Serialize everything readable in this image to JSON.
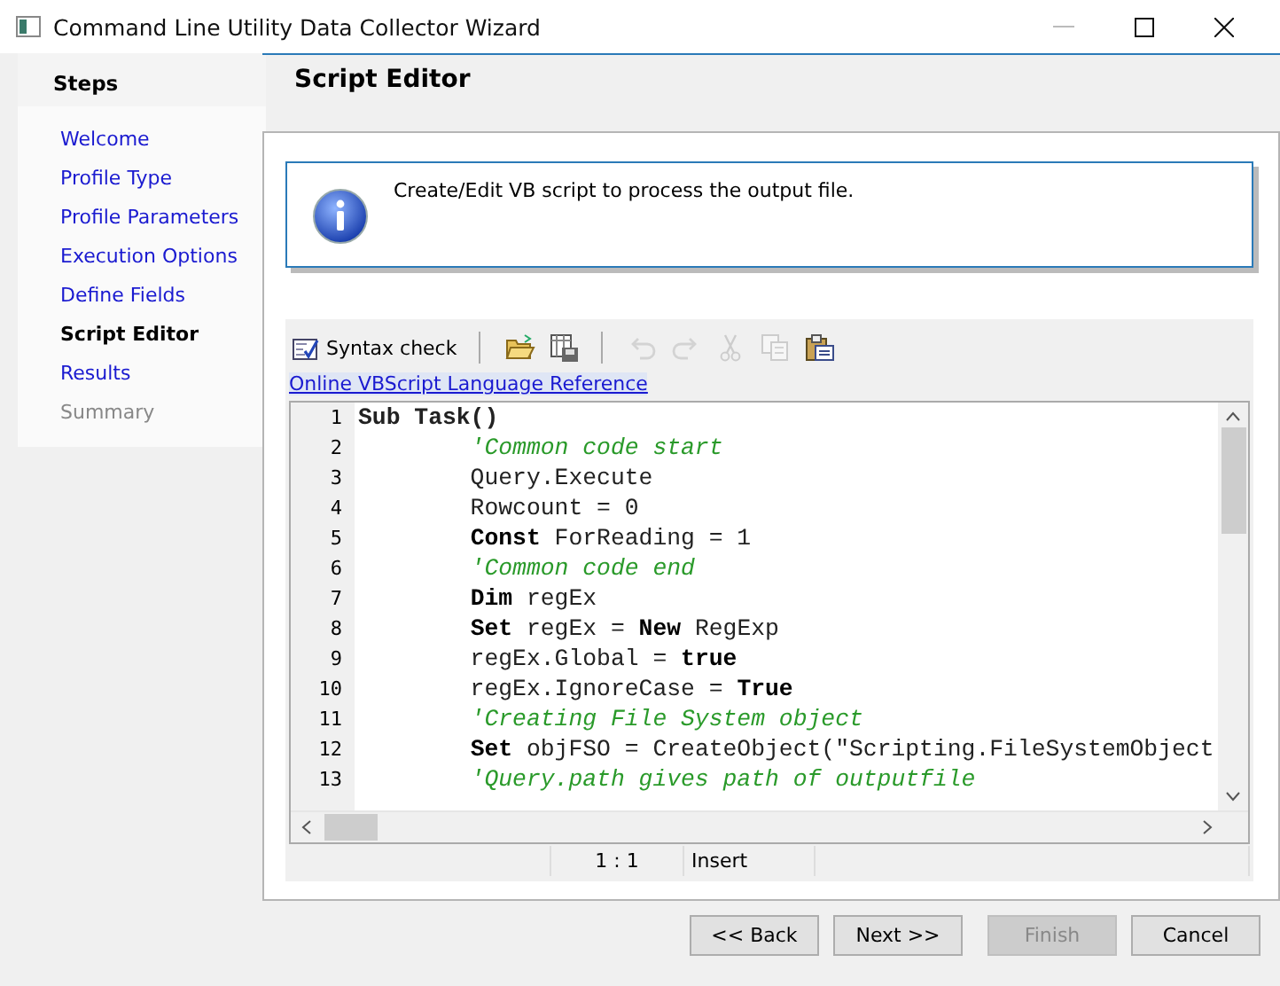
{
  "window": {
    "title": "Command Line Utility Data Collector Wizard"
  },
  "sidebar": {
    "heading": "Steps",
    "items": [
      {
        "label": "Welcome",
        "selected": false,
        "disabled": false
      },
      {
        "label": "Profile Type",
        "selected": false,
        "disabled": false
      },
      {
        "label": "Profile Parameters",
        "selected": false,
        "disabled": false
      },
      {
        "label": "Execution Options",
        "selected": false,
        "disabled": false
      },
      {
        "label": "Define Fields",
        "selected": false,
        "disabled": false
      },
      {
        "label": "Script Editor",
        "selected": true,
        "disabled": false
      },
      {
        "label": "Results",
        "selected": false,
        "disabled": false
      },
      {
        "label": "Summary",
        "selected": false,
        "disabled": true
      }
    ]
  },
  "page_title": "Script Editor",
  "info": {
    "message": "Create/Edit VB script to process the output file."
  },
  "toolbar": {
    "syntax_check": "Syntax check",
    "tools": [
      {
        "kind": "open",
        "disabled": false
      },
      {
        "kind": "save",
        "disabled": false
      },
      {
        "kind": "undo",
        "disabled": true
      },
      {
        "kind": "redo",
        "disabled": true
      },
      {
        "kind": "cut",
        "disabled": true
      },
      {
        "kind": "copy",
        "disabled": true
      },
      {
        "kind": "paste",
        "disabled": false
      }
    ]
  },
  "reference_link": "Online VBScript Language Reference",
  "editor": {
    "lines": [
      {
        "number": "1",
        "kind": "bold",
        "code": "Sub Task()"
      },
      {
        "number": "2",
        "kind": "comment",
        "code": "        'Common code start"
      },
      {
        "number": "3",
        "kind": "code",
        "code": "        Query.Execute"
      },
      {
        "number": "4",
        "kind": "code",
        "code": "        Rowcount = 0"
      },
      {
        "number": "5",
        "kind": "code",
        "code": "        **Const** ForReading = 1"
      },
      {
        "number": "6",
        "kind": "comment",
        "code": "        'Common code end"
      },
      {
        "number": "7",
        "kind": "code",
        "code": "        **Dim** regEx"
      },
      {
        "number": "8",
        "kind": "code",
        "code": "        **Set** regEx = **New** RegExp"
      },
      {
        "number": "9",
        "kind": "code",
        "code": "        regEx.Global = **true**"
      },
      {
        "number": "10",
        "kind": "code",
        "code": "        regEx.IgnoreCase = **True**"
      },
      {
        "number": "11",
        "kind": "comment",
        "code": "        'Creating File System object"
      },
      {
        "number": "12",
        "kind": "code",
        "code": "        **Set** objFSO = CreateObject(\"Scripting.FileSystemObject"
      },
      {
        "number": "13",
        "kind": "comment",
        "code": "        'Query.path gives path of outputfile"
      }
    ]
  },
  "status_bar": {
    "position": "1 : 1",
    "mode": "Insert"
  },
  "buttons": [
    {
      "label": "<< Back",
      "disabled": false
    },
    {
      "label": "Next >>",
      "disabled": false
    },
    {
      "label": "Finish",
      "disabled": true
    },
    {
      "label": "Cancel",
      "disabled": false
    }
  ]
}
